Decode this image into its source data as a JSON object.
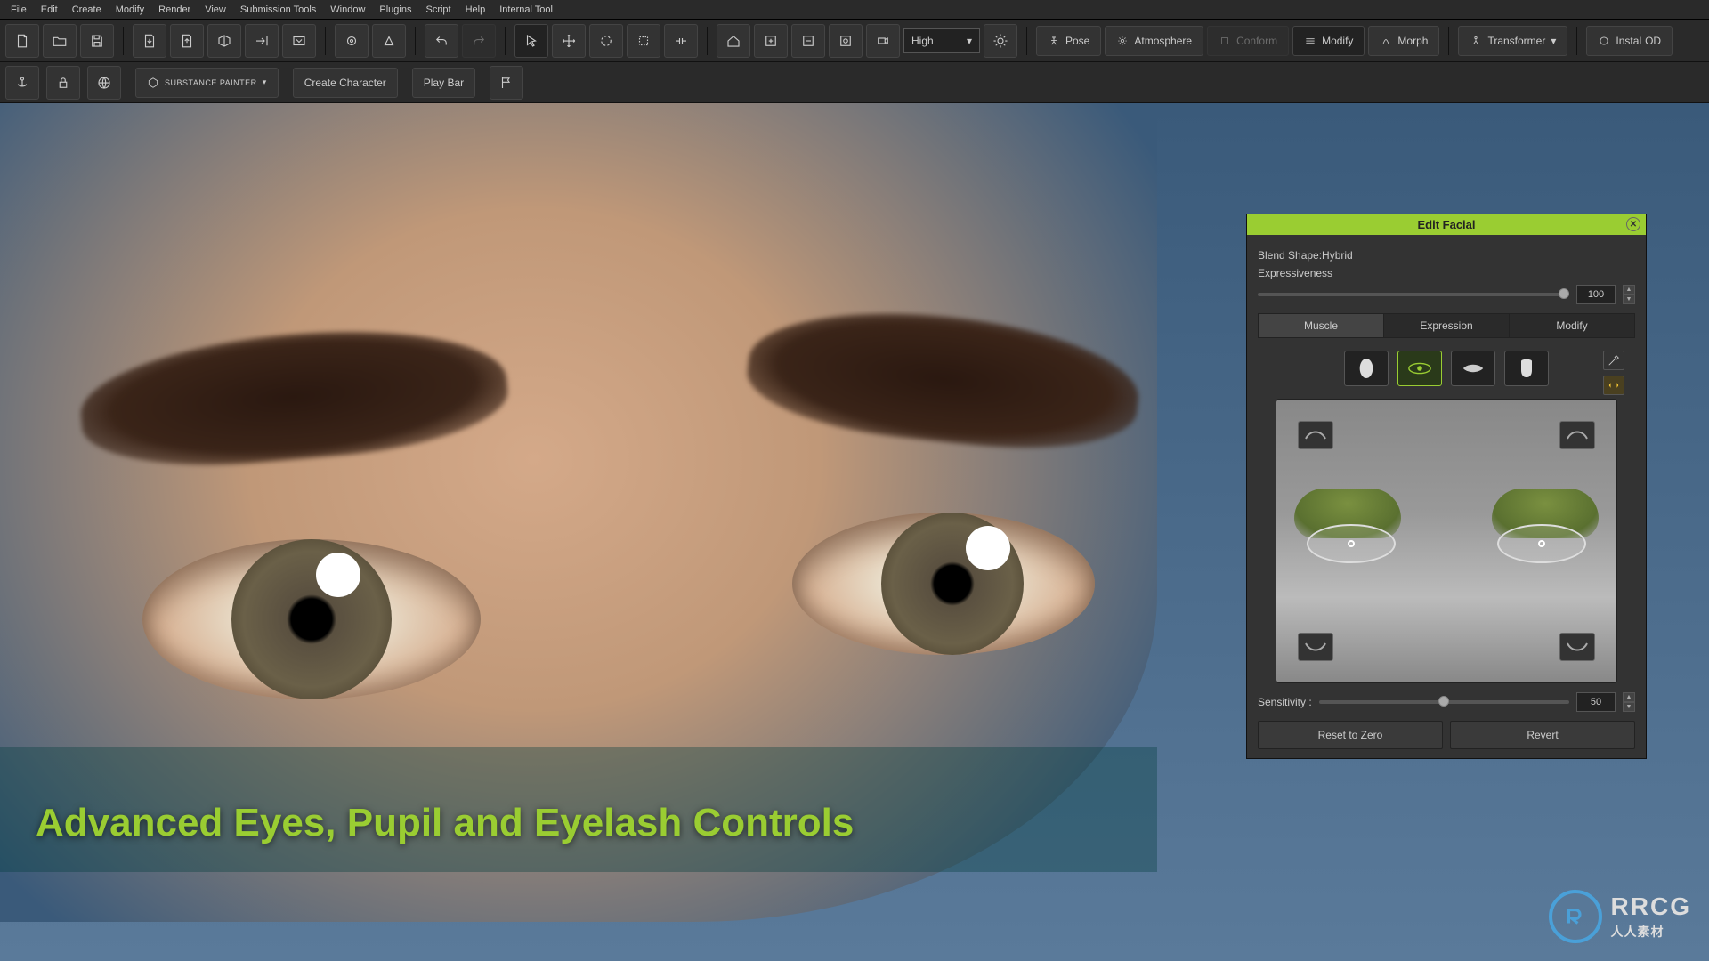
{
  "menu": [
    "File",
    "Edit",
    "Create",
    "Modify",
    "Render",
    "View",
    "Submission Tools",
    "Window",
    "Plugins",
    "Script",
    "Help",
    "Internal Tool"
  ],
  "toolbar": {
    "quality_label": "High",
    "pose": "Pose",
    "atmosphere": "Atmosphere",
    "conform": "Conform",
    "modify": "Modify",
    "morph": "Morph",
    "transformer": "Transformer",
    "instalod": "InstaLOD"
  },
  "toolbar2": {
    "substance": "SUBSTANCE PAINTER",
    "create_character": "Create Character",
    "play_bar": "Play Bar"
  },
  "caption": "Advanced Eyes, Pupil and Eyelash Controls",
  "watermark": {
    "brand": "RRCG",
    "sub": "人人素材"
  },
  "panel": {
    "title": "Edit Facial",
    "blend_shape": "Blend Shape:Hybrid",
    "expressiveness_label": "Expressiveness",
    "expressiveness_value": "100",
    "tabs": {
      "muscle": "Muscle",
      "expression": "Expression",
      "modify": "Modify"
    },
    "sensitivity_label": "Sensitivity :",
    "sensitivity_value": "50",
    "reset": "Reset to Zero",
    "revert": "Revert"
  }
}
